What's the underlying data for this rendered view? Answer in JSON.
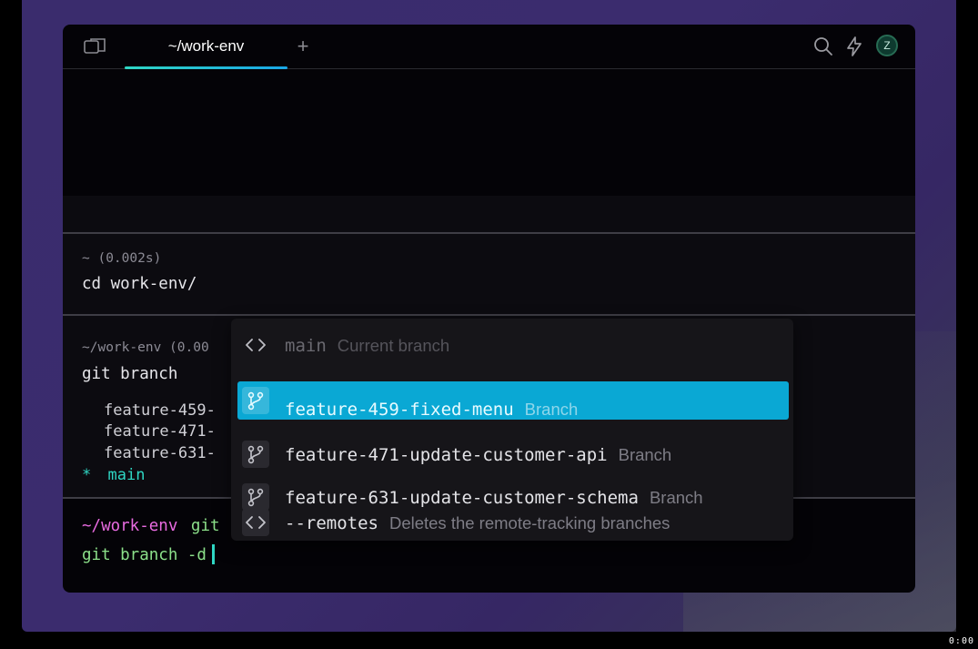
{
  "tabbar": {
    "tab_title": "~/work-env",
    "new_tab": "+",
    "icons": {
      "panel": "panel-toggle-icon",
      "search": "search-icon",
      "bolt": "lightning-icon"
    },
    "avatar_initial": "Z"
  },
  "blocks": [
    {
      "meta": "~ (0.002s)",
      "command": "cd work-env/"
    },
    {
      "meta": "~/work-env (0.00",
      "command": "git branch",
      "output": [
        "feature-459-",
        "feature-471-",
        "feature-631-"
      ],
      "current_marker": "*",
      "current_branch": "main"
    }
  ],
  "prompt": {
    "path": "~/work-env",
    "branch_label": "git"
  },
  "input": {
    "text": "git branch -d"
  },
  "autocomplete": {
    "items": [
      {
        "icon": "code-icon",
        "label": "main",
        "description": "Current branch"
      },
      {
        "icon": "git-branch-icon",
        "label": "feature-459-fixed-menu",
        "description": "Branch",
        "selected": true
      },
      {
        "icon": "git-branch-icon",
        "label": "feature-471-update-customer-api",
        "description": "Branch"
      },
      {
        "icon": "git-branch-icon",
        "label": "feature-631-update-customer-schema",
        "description": "Branch"
      },
      {
        "icon": "code-icon",
        "label": "--remotes",
        "description": "Deletes the remote-tracking branches"
      }
    ]
  },
  "timestamp": "0:00",
  "colors": {
    "accent": "#2fd7c4",
    "selection": "#0aa8d4",
    "prompt_path": "#e86be0",
    "prompt_git": "#8ce08a"
  }
}
